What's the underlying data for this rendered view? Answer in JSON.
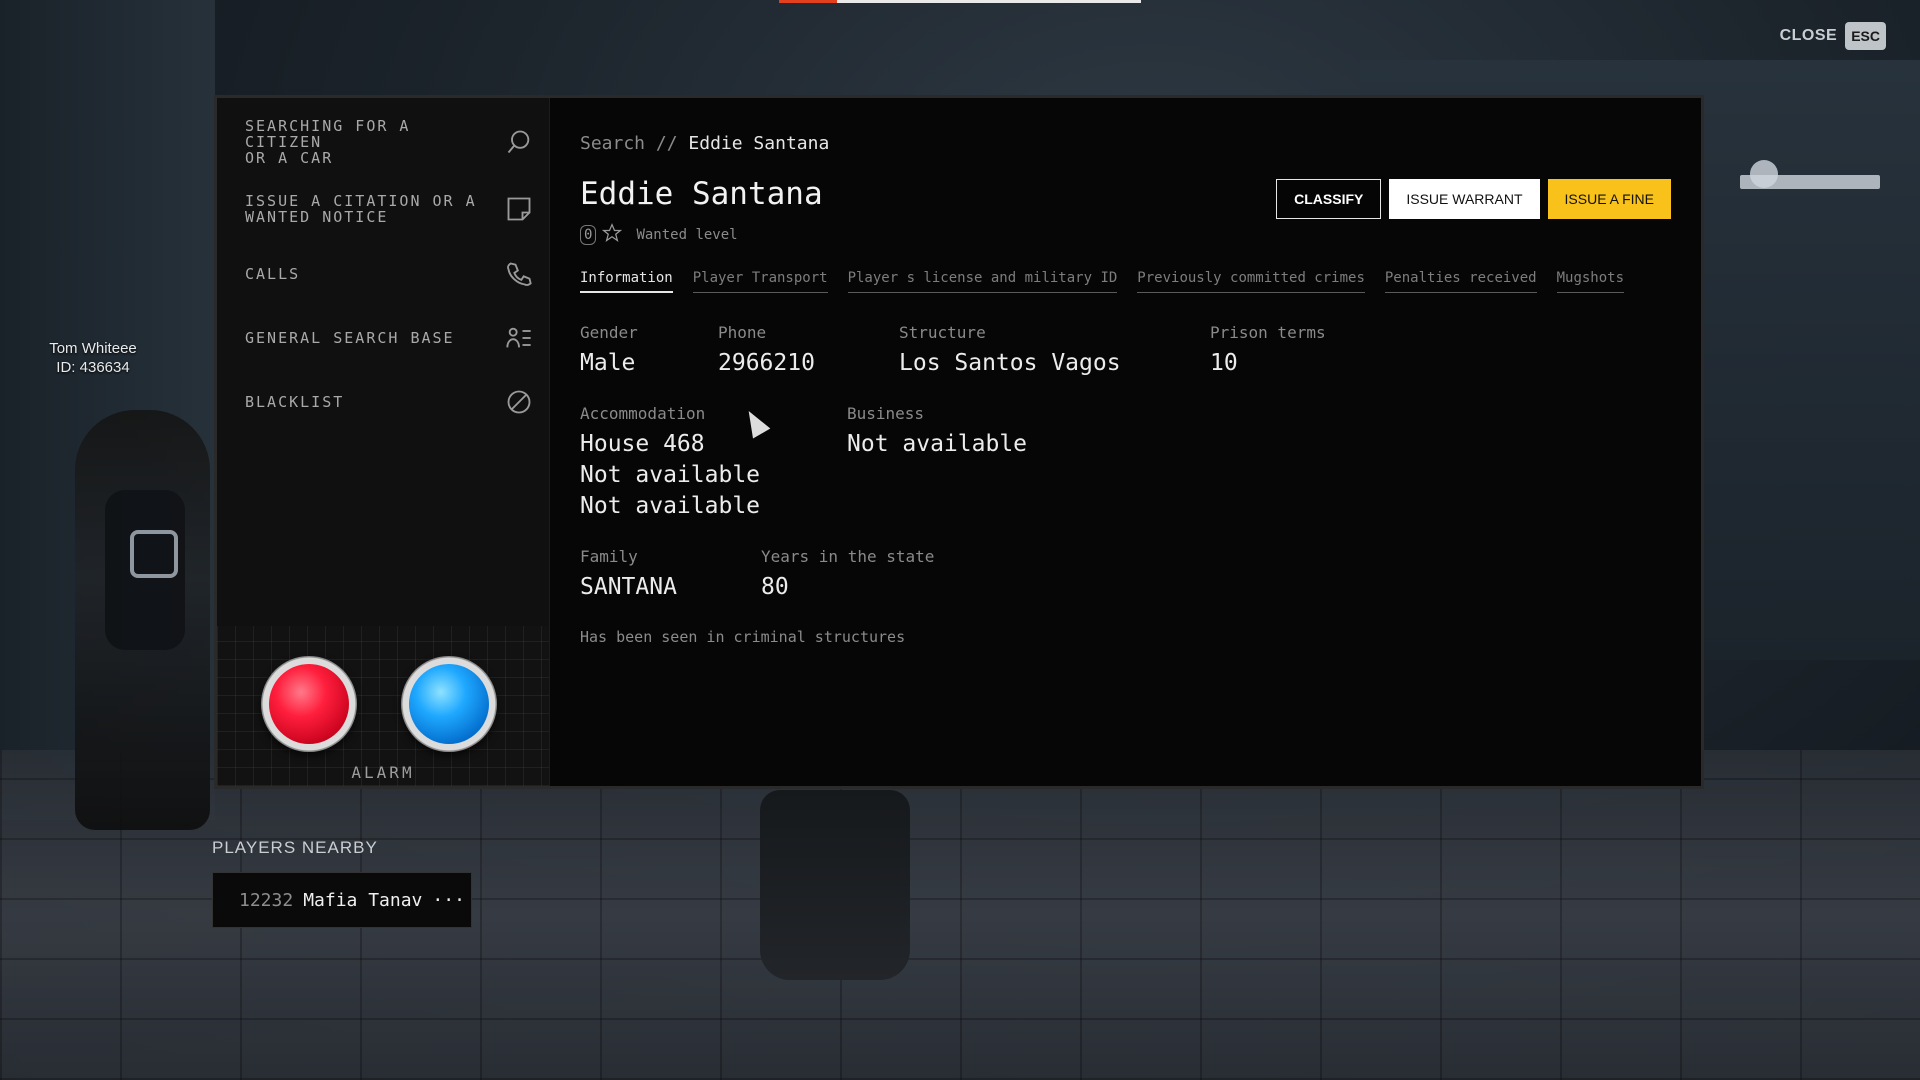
{
  "hud": {
    "progress": 0.16,
    "close_label": "CLOSE",
    "esc_label": "ESC",
    "player_tag_name": "Tom Whiteee",
    "player_tag_id": "ID: 436634"
  },
  "sidebar": {
    "items": [
      {
        "label": "SEARCHING FOR A\nCITIZEN\nOR A CAR",
        "icon": "search-icon"
      },
      {
        "label": "ISSUE A CITATION OR A\nWANTED NOTICE",
        "icon": "note-icon"
      },
      {
        "label": "CALLS",
        "icon": "phone-icon"
      },
      {
        "label": "GENERAL SEARCH BASE",
        "icon": "user-list-icon"
      },
      {
        "label": "BLACKLIST",
        "icon": "block-icon"
      }
    ],
    "alarm_label": "ALARM",
    "alarm_colors": {
      "red": "#ff1f3d",
      "blue": "#1fa8ff"
    }
  },
  "breadcrumb": {
    "root": "Search",
    "separator": "//",
    "current": "Eddie Santana"
  },
  "citizen": {
    "name": "Eddie Santana",
    "wanted_count": "0",
    "wanted_label": "Wanted level"
  },
  "actions": {
    "classify": "CLASSIFY",
    "issue_warrant": "ISSUE WARRANT",
    "issue_fine": "ISSUE A FINE",
    "fine_color": "#f9c21a"
  },
  "tabs": [
    "Information",
    "Player Transport",
    "Player s license and military ID",
    "Previously committed crimes",
    "Penalties received",
    "Mugshots"
  ],
  "info": {
    "gender_label": "Gender",
    "gender": "Male",
    "phone_label": "Phone",
    "phone": "2966210",
    "structure_label": "Structure",
    "structure": "Los Santos Vagos",
    "prison_label": "Prison terms",
    "prison": "10",
    "accommodation_label": "Accommodation",
    "accommodation": [
      "House 468",
      "Not available",
      "Not available"
    ],
    "business_label": "Business",
    "business": "Not available",
    "family_label": "Family",
    "family": "SANTANA",
    "years_label": "Years in the state",
    "years": "80",
    "note": "Has been seen in criminal structures"
  },
  "nearby": {
    "title": "PLAYERS NEARBY",
    "players": [
      {
        "id": "12232",
        "name": "Mafia Tanav",
        "more": "···"
      }
    ]
  }
}
